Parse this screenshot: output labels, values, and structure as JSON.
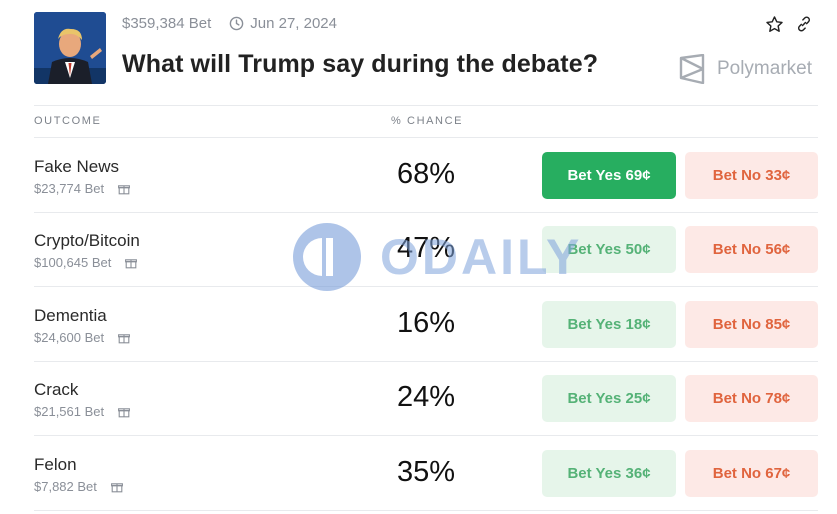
{
  "market": {
    "volume": "$359,384 Bet",
    "date": "Jun 27, 2024",
    "title": "What will Trump say during the debate?",
    "brand": "Polymarket"
  },
  "columns": {
    "outcome": "OUTCOME",
    "chance": "% CHANCE"
  },
  "outcomes": [
    {
      "name": "Fake News",
      "volume": "$23,774 Bet",
      "chance": "68%",
      "yes": "Bet Yes 69¢",
      "no": "Bet No 33¢"
    },
    {
      "name": "Crypto/Bitcoin",
      "volume": "$100,645 Bet",
      "chance": "47%",
      "yes": "Bet Yes 50¢",
      "no": "Bet No 56¢"
    },
    {
      "name": "Dementia",
      "volume": "$24,600 Bet",
      "chance": "16%",
      "yes": "Bet Yes 18¢",
      "no": "Bet No 85¢"
    },
    {
      "name": "Crack",
      "volume": "$21,561 Bet",
      "chance": "24%",
      "yes": "Bet Yes 25¢",
      "no": "Bet No 78¢"
    },
    {
      "name": "Felon",
      "volume": "$7,882 Bet",
      "chance": "35%",
      "yes": "Bet Yes 36¢",
      "no": "Bet No 67¢"
    }
  ],
  "watermark": {
    "text": "ODAILY"
  },
  "colors": {
    "yes_active": "#27ae60",
    "yes_bg": "#e6f5ea",
    "yes_text": "#55b277",
    "no_bg": "#fde9e6",
    "no_text": "#e0643e"
  }
}
